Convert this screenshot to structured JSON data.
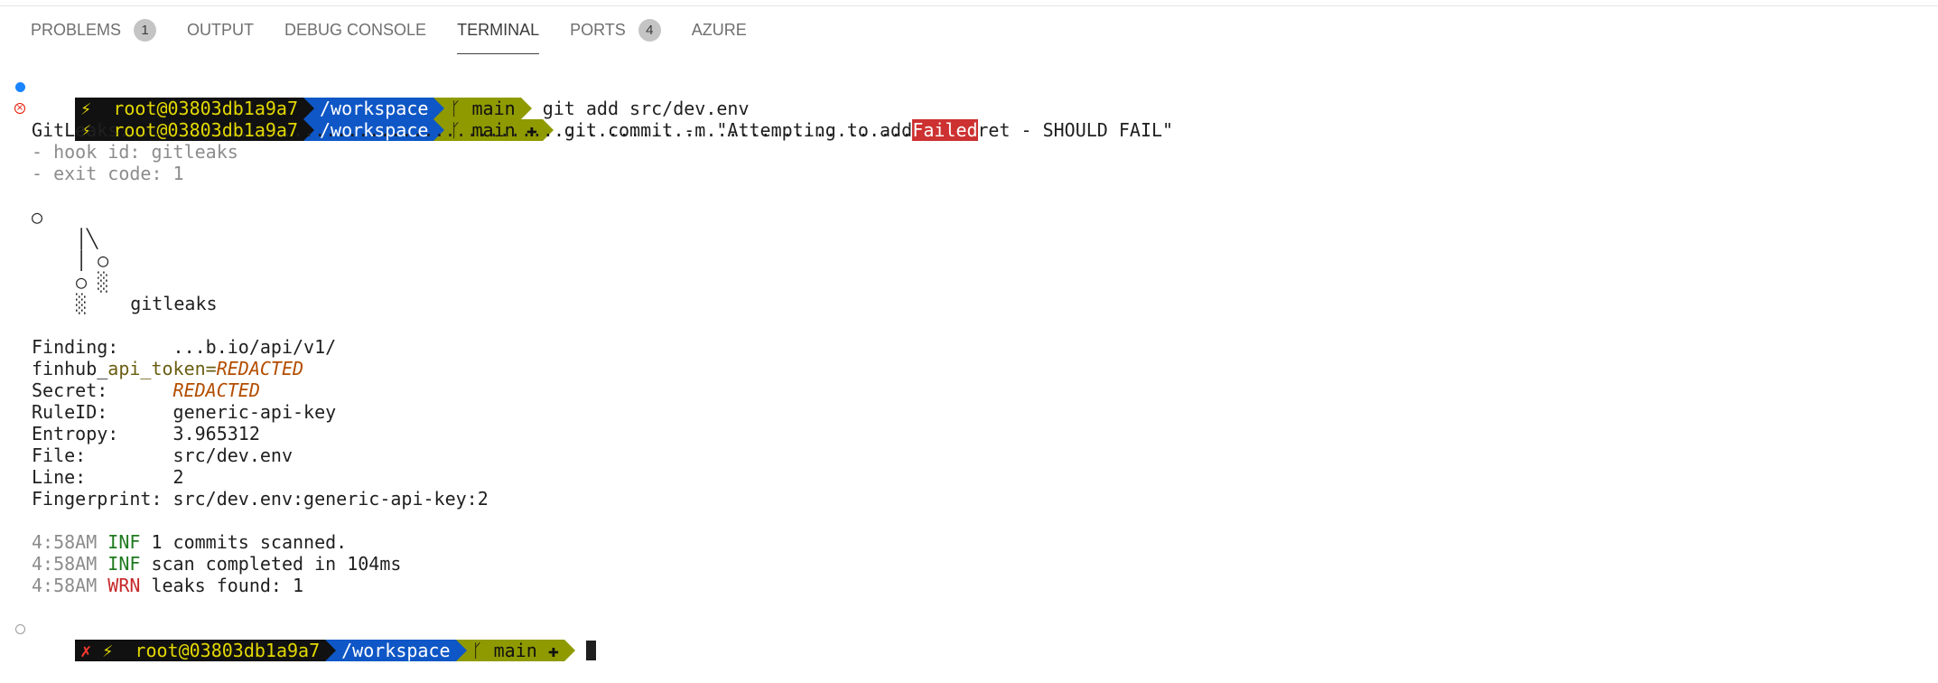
{
  "tabs": [
    {
      "label": "PROBLEMS",
      "badge": "1"
    },
    {
      "label": "OUTPUT"
    },
    {
      "label": "DEBUG CONSOLE"
    },
    {
      "label": "TERMINAL",
      "active": true
    },
    {
      "label": "PORTS",
      "badge": "4"
    },
    {
      "label": "AZURE"
    }
  ],
  "prompt": {
    "bolt": "⚡",
    "user_host": "root@03803db1a9a7",
    "path": "/workspace",
    "branch_icon": "ᚴ",
    "branch": "main",
    "dirty": "✚",
    "error_mark": "✗"
  },
  "commands": {
    "git_add": "git add src/dev.env",
    "git_commit": "git commit -m \"Attempting to add a secret - SHOULD FAIL\""
  },
  "hook": {
    "name_dots": "GitLeaks.........................................................................",
    "status": "Failed",
    "hook_id": "- hook id: gitleaks",
    "exit_code": "- exit code: 1"
  },
  "logo": {
    "l1": "○",
    "l2": "│╲",
    "l3": "│ ○",
    "l4": "○ ░",
    "l5": "░    gitleaks"
  },
  "finding": {
    "finding_label": "Finding:     ",
    "finding_value": "...b.io/api/v1/",
    "finhub_prefix": "finhub_",
    "finhub_key": "api_token=",
    "finhub_value": "REDACTED",
    "secret_label": "Secret:      ",
    "secret_value": "REDACTED",
    "rule_label": "RuleID:      ",
    "rule_value": "generic-api-key",
    "entropy_label": "Entropy:     ",
    "entropy_value": "3.965312",
    "file_label": "File:        ",
    "file_value": "src/dev.env",
    "line_label": "Line:        ",
    "line_value": "2",
    "fingerprint_label": "Fingerprint: ",
    "fingerprint_value": "src/dev.env:generic-api-key:2"
  },
  "logs": [
    {
      "time": "4:58AM",
      "level": "INF",
      "msg": "1 commits scanned."
    },
    {
      "time": "4:58AM",
      "level": "INF",
      "msg": "scan completed in 104ms"
    },
    {
      "time": "4:58AM",
      "level": "WRN",
      "msg": "leaks found: 1"
    }
  ],
  "icons": {
    "success_dot": "blue-dot-icon",
    "error_dot": "error-circle-icon",
    "pending_dot": "hollow-circle-icon"
  },
  "colors": {
    "prompt_dark": "#111111",
    "prompt_blue": "#0f57c6",
    "prompt_olive": "#8f9a00",
    "failed_bg": "#cd3131",
    "inf": "#1f7a1f",
    "wrn": "#c62828"
  }
}
